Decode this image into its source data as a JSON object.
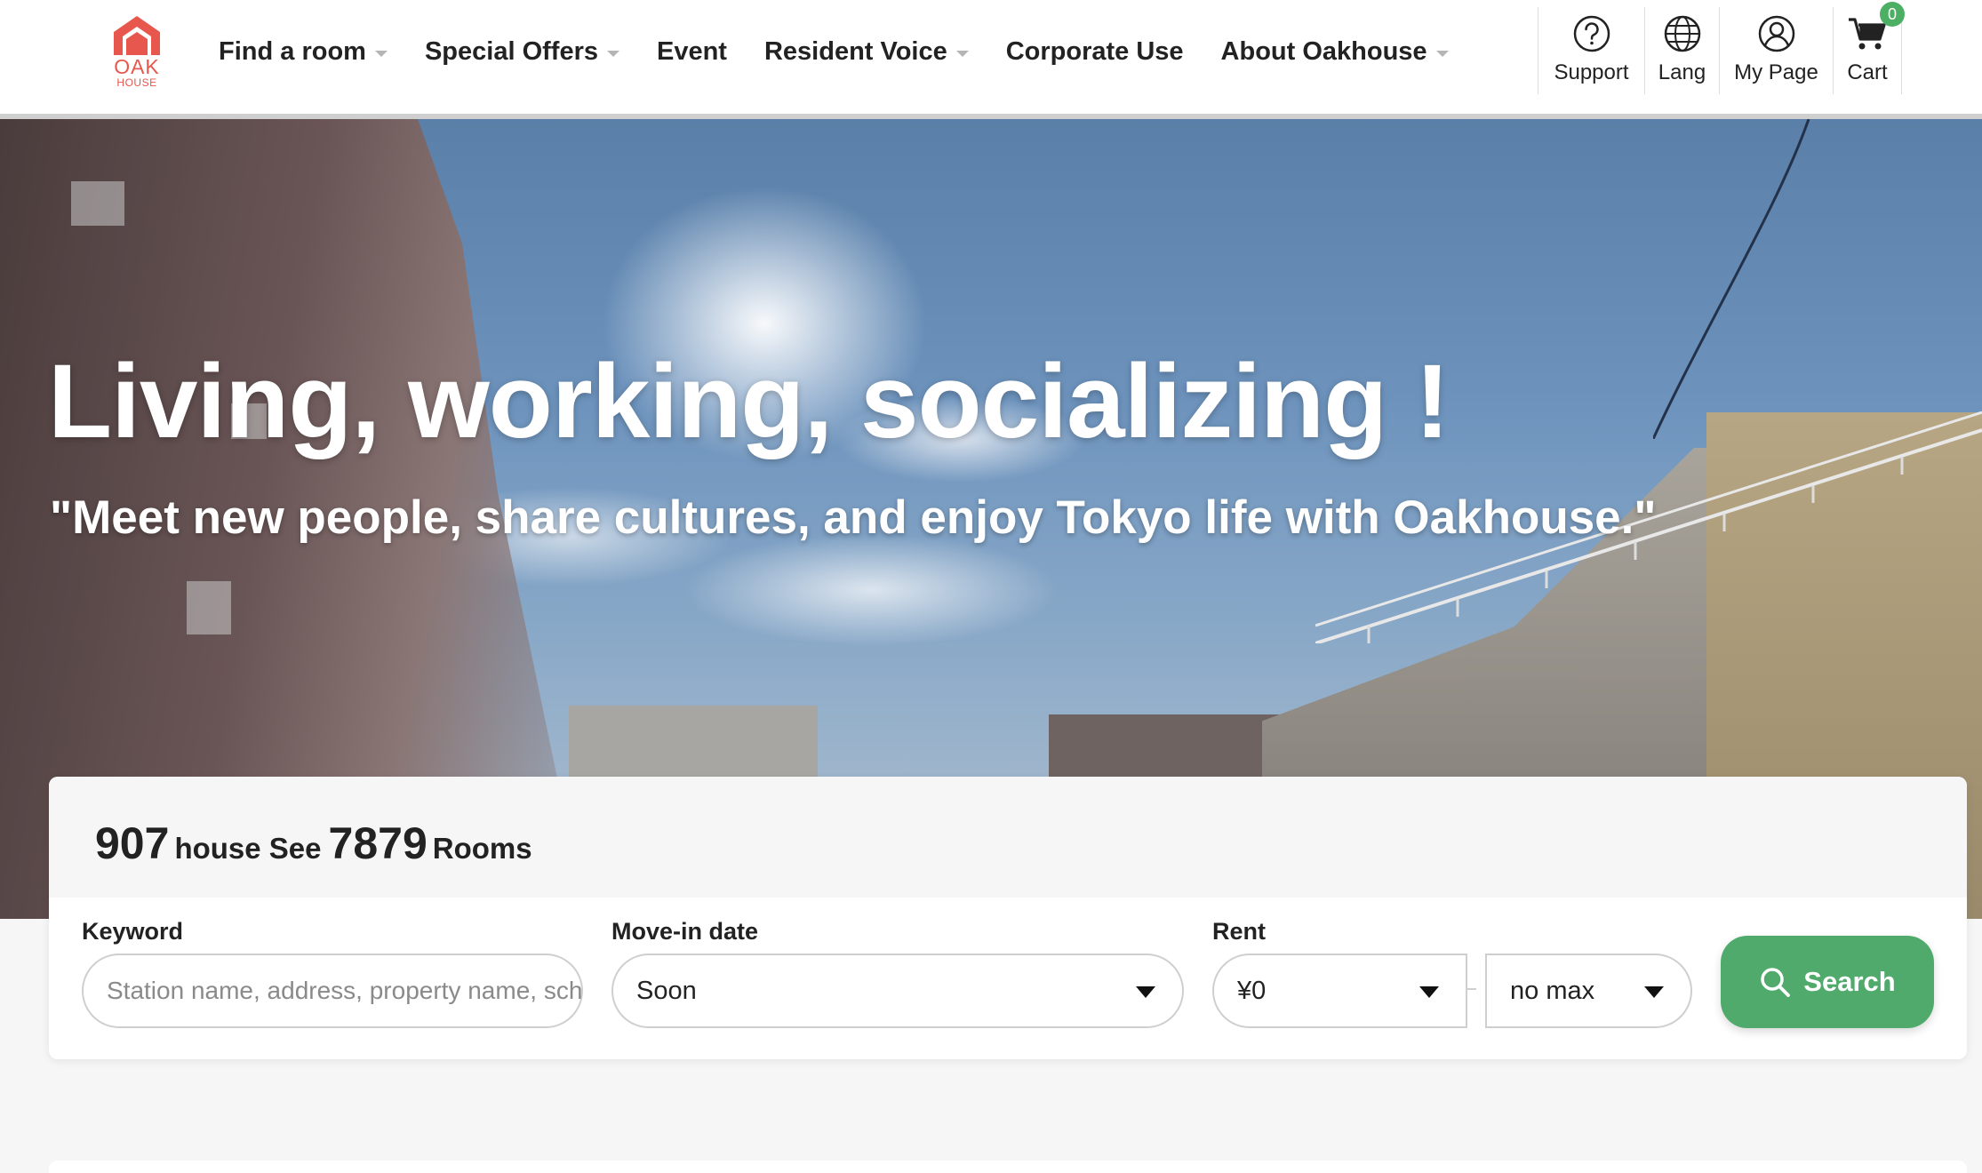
{
  "brand": {
    "logo_text": "OAK",
    "logo_sub": "HOUSE",
    "accent_color": "#e8574d",
    "logo_icon": "house-icon"
  },
  "nav": {
    "items": [
      {
        "label": "Find a room",
        "has_dropdown": true
      },
      {
        "label": "Special Offers",
        "has_dropdown": true
      },
      {
        "label": "Event",
        "has_dropdown": false
      },
      {
        "label": "Resident Voice",
        "has_dropdown": true
      },
      {
        "label": "Corporate Use",
        "has_dropdown": false
      },
      {
        "label": "About Oakhouse",
        "has_dropdown": true
      }
    ]
  },
  "utility": {
    "support": {
      "label": "Support",
      "icon": "help-circle-icon"
    },
    "lang": {
      "label": "Lang",
      "icon": "globe-icon"
    },
    "mypage": {
      "label": "My Page",
      "icon": "user-icon"
    },
    "cart": {
      "label": "Cart",
      "icon": "cart-icon",
      "count": "0",
      "badge_color": "#4caf63"
    }
  },
  "hero": {
    "title": "Living, working, socializing !",
    "subtitle": "\"Meet new people, share cultures, and enjoy Tokyo life with Oakhouse.\""
  },
  "search": {
    "house_count": "907",
    "house_word": "house See",
    "room_count": "7879",
    "room_word": "Rooms",
    "keyword": {
      "label": "Keyword",
      "placeholder": "Station name, address, property name, school name",
      "value": ""
    },
    "move_in": {
      "label": "Move-in date",
      "selected": "Soon"
    },
    "rent": {
      "label": "Rent",
      "min_selected": "¥0",
      "max_selected": "no max"
    },
    "button_label": "Search",
    "button_icon": "search-icon",
    "button_color": "#4faa6c"
  }
}
